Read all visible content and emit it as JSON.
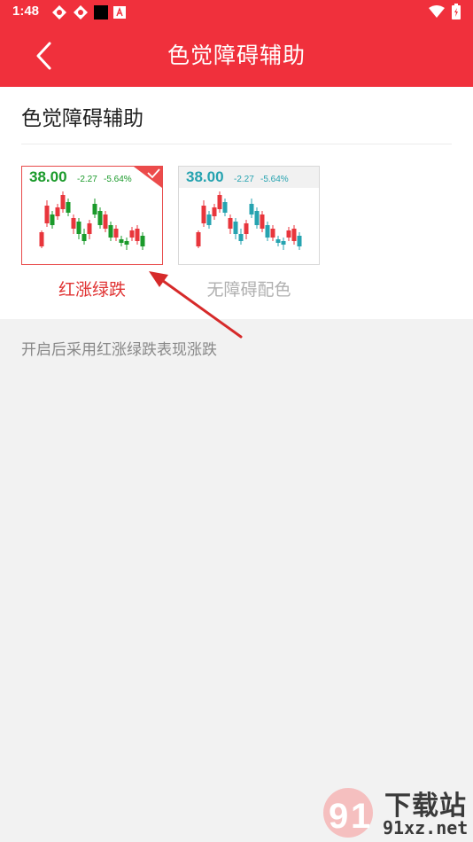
{
  "status_bar": {
    "time": "1:48",
    "icons": [
      "sync-icon",
      "sync-icon",
      "black-square-icon",
      "a-box-icon"
    ],
    "right_icons": [
      "wifi-icon",
      "battery-charging-icon"
    ]
  },
  "app_bar": {
    "back_icon": "chevron-left-icon",
    "title": "色觉障碍辅助"
  },
  "section": {
    "title": "色觉障碍辅助",
    "options": [
      {
        "label": "红涨绿跌",
        "price": "38.00",
        "change": "-2.27",
        "change_pct": "-5.64%",
        "selected": true,
        "up_color": "#e8363c",
        "down_color": "#1a9a2a",
        "price_color": "#1a9a2a",
        "label_color": "#e03333"
      },
      {
        "label": "无障碍配色",
        "price": "38.00",
        "change": "-2.27",
        "change_pct": "-5.64%",
        "selected": false,
        "up_color": "#e8363c",
        "down_color": "#26a3b0",
        "price_color": "#26a3b0",
        "label_color": "#b0b0b0"
      }
    ]
  },
  "description": "开启后采用红涨绿跌表现涨跌",
  "watermark": {
    "line1": "下载站",
    "line2": "91xz.net"
  },
  "colors": {
    "brand": "#f0303c",
    "background": "#f2f2f2"
  }
}
